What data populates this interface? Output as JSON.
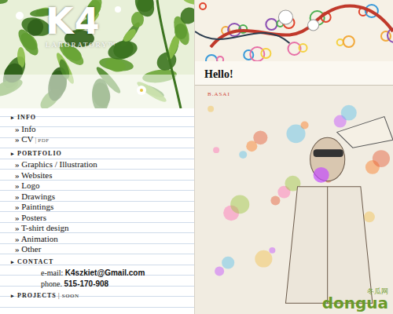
{
  "logo": {
    "mark": "K4",
    "sub": "LABORATORY™"
  },
  "menu": {
    "bullet": "»",
    "marker": "▸",
    "sep": "|",
    "sections": [
      {
        "title": "INFO",
        "items": [
          {
            "label": "Info",
            "note": ""
          },
          {
            "label": "CV",
            "note": "PDF"
          }
        ]
      },
      {
        "title": "PORTFOLIO",
        "items": [
          {
            "label": "Graphics / Illustration",
            "note": ""
          },
          {
            "label": "Websites",
            "note": ""
          },
          {
            "label": "Logo",
            "note": ""
          },
          {
            "label": "Drawings",
            "note": ""
          },
          {
            "label": "Paintings",
            "note": ""
          },
          {
            "label": "Posters",
            "note": ""
          },
          {
            "label": "T-shirt design",
            "note": ""
          },
          {
            "label": "Animation",
            "note": ""
          },
          {
            "label": "Other",
            "note": ""
          }
        ]
      },
      {
        "title": "CONTACT",
        "items": []
      }
    ],
    "contact": [
      {
        "label": "e-mail:",
        "value": "K4szkiet@Gmail.com"
      },
      {
        "label": "phone.",
        "value": "515-170-908"
      }
    ],
    "projects": {
      "title": "PROJECTS",
      "note": "SOON"
    }
  },
  "content": {
    "greeting": "Hello!",
    "signature": "B.ASAI"
  },
  "watermark": {
    "cn": "冬瓜网",
    "en": "dongua"
  }
}
